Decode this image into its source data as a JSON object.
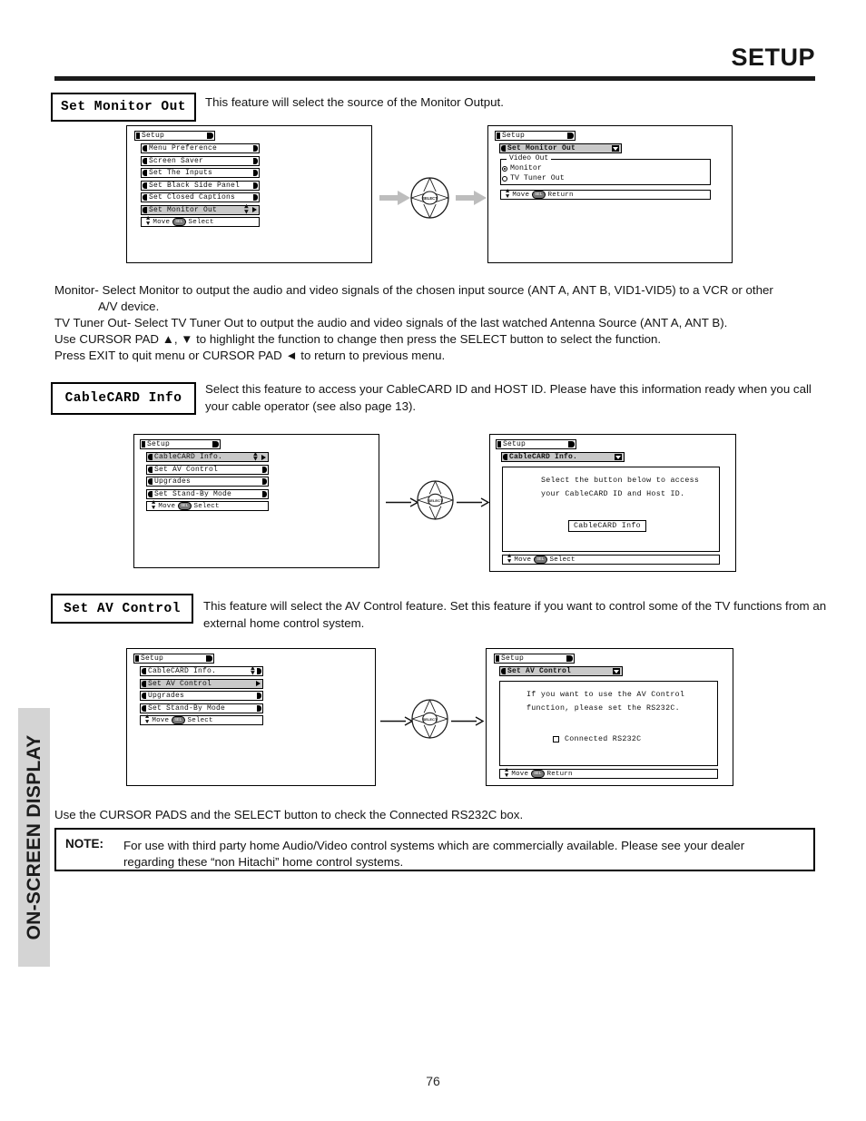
{
  "header": {
    "title": "SETUP",
    "rule": true
  },
  "side_tab": {
    "label": "ON-SCREEN DISPLAY"
  },
  "page_number": "76",
  "sections": [
    {
      "chip_label": "Set Monitor Out",
      "description": "This feature will select the source of the Monitor Output.",
      "left_menu": {
        "title": "Setup",
        "items": [
          "Menu Preference",
          "Screen Saver",
          "Set The Inputs",
          "Set Black Side Panel",
          "Set Closed Captions",
          "Set Monitor Out"
        ],
        "selected_index": 5,
        "footer": {
          "move": "Move",
          "select_key": "SEL",
          "action": "Select"
        }
      },
      "right_menu": {
        "title": "Setup",
        "header_bar": "Set Monitor Out",
        "group_label": "Video Out",
        "options": [
          {
            "label": "Monitor",
            "checked": true
          },
          {
            "label": "TV Tuner Out",
            "checked": false
          }
        ],
        "footer": {
          "move": "Move",
          "select_key": "SEL",
          "action": "Return"
        }
      },
      "pad_label": "SELECT"
    },
    {
      "chip_label": "CableCARD Info",
      "description": "Select this feature to access your CableCARD ID and HOST ID.  Please have this information ready when you call your cable operator (see also page 13).",
      "left_menu": {
        "title": "Setup",
        "items": [
          "CableCARD Info.",
          "Set AV Control",
          "Upgrades",
          "Set Stand-By Mode"
        ],
        "selected_index": 0,
        "footer": {
          "move": "Move",
          "select_key": "SEL",
          "action": "Select"
        }
      },
      "right_menu": {
        "title": "Setup",
        "header_bar": "CableCARD Info.",
        "body_lines": [
          "Select the button below to access",
          "your CableCARD ID and Host ID."
        ],
        "button_label": "CableCARD Info",
        "footer": {
          "move": "Move",
          "select_key": "SEL",
          "action": "Select"
        }
      },
      "pad_label": "SELECT"
    },
    {
      "chip_label": "Set AV Control",
      "description": "This feature will select the AV Control feature.  Set this feature if you want to control some of the TV functions from an external home control system.",
      "left_menu": {
        "title": "Setup",
        "items": [
          "CableCARD Info.",
          "Set AV Control",
          "Upgrades",
          "Set Stand-By Mode"
        ],
        "selected_index": 1,
        "footer": {
          "move": "Move",
          "select_key": "SEL",
          "action": "Select"
        }
      },
      "right_menu": {
        "title": "Setup",
        "header_bar": "Set AV Control",
        "body_lines": [
          "If you want to use the AV Control",
          "function, please set the RS232C."
        ],
        "checkbox_label": "Connected RS232C",
        "checkbox_checked": false,
        "footer": {
          "move": "Move",
          "select_key": "SEL",
          "action": "Return"
        }
      },
      "pad_label": "SELECT"
    }
  ],
  "body_text": {
    "monitor_line_1": "Monitor- Select Monitor to output the audio and video signals of the chosen input source (ANT A, ANT B, VID1-VID5) to a VCR or other",
    "monitor_line_2": "A/V device.",
    "tuner_line": "TV Tuner Out- Select TV Tuner Out to output the audio and video signals of the last watched Antenna Source (ANT A, ANT B).",
    "cursor_line": "Use CURSOR PAD ▲, ▼ to highlight the function to change then press the SELECT button to select the function.",
    "exit_line": "Press EXIT to quit menu or CURSOR PAD ◄ to return to previous menu.",
    "rs232c_line": "Use the CURSOR PADS and the SELECT button to check the Connected RS232C box."
  },
  "note": {
    "label": "NOTE:",
    "line_1": "For use with third party home Audio/Video control systems which are commercially available.  Please see your dealer",
    "line_2": "regarding these “non Hitachi” home control systems."
  },
  "colors": {
    "rule": "#1b1b1b",
    "side_tab_bg": "#d4d4d4",
    "highlight": "#c9c9c9",
    "text": "#111111"
  }
}
